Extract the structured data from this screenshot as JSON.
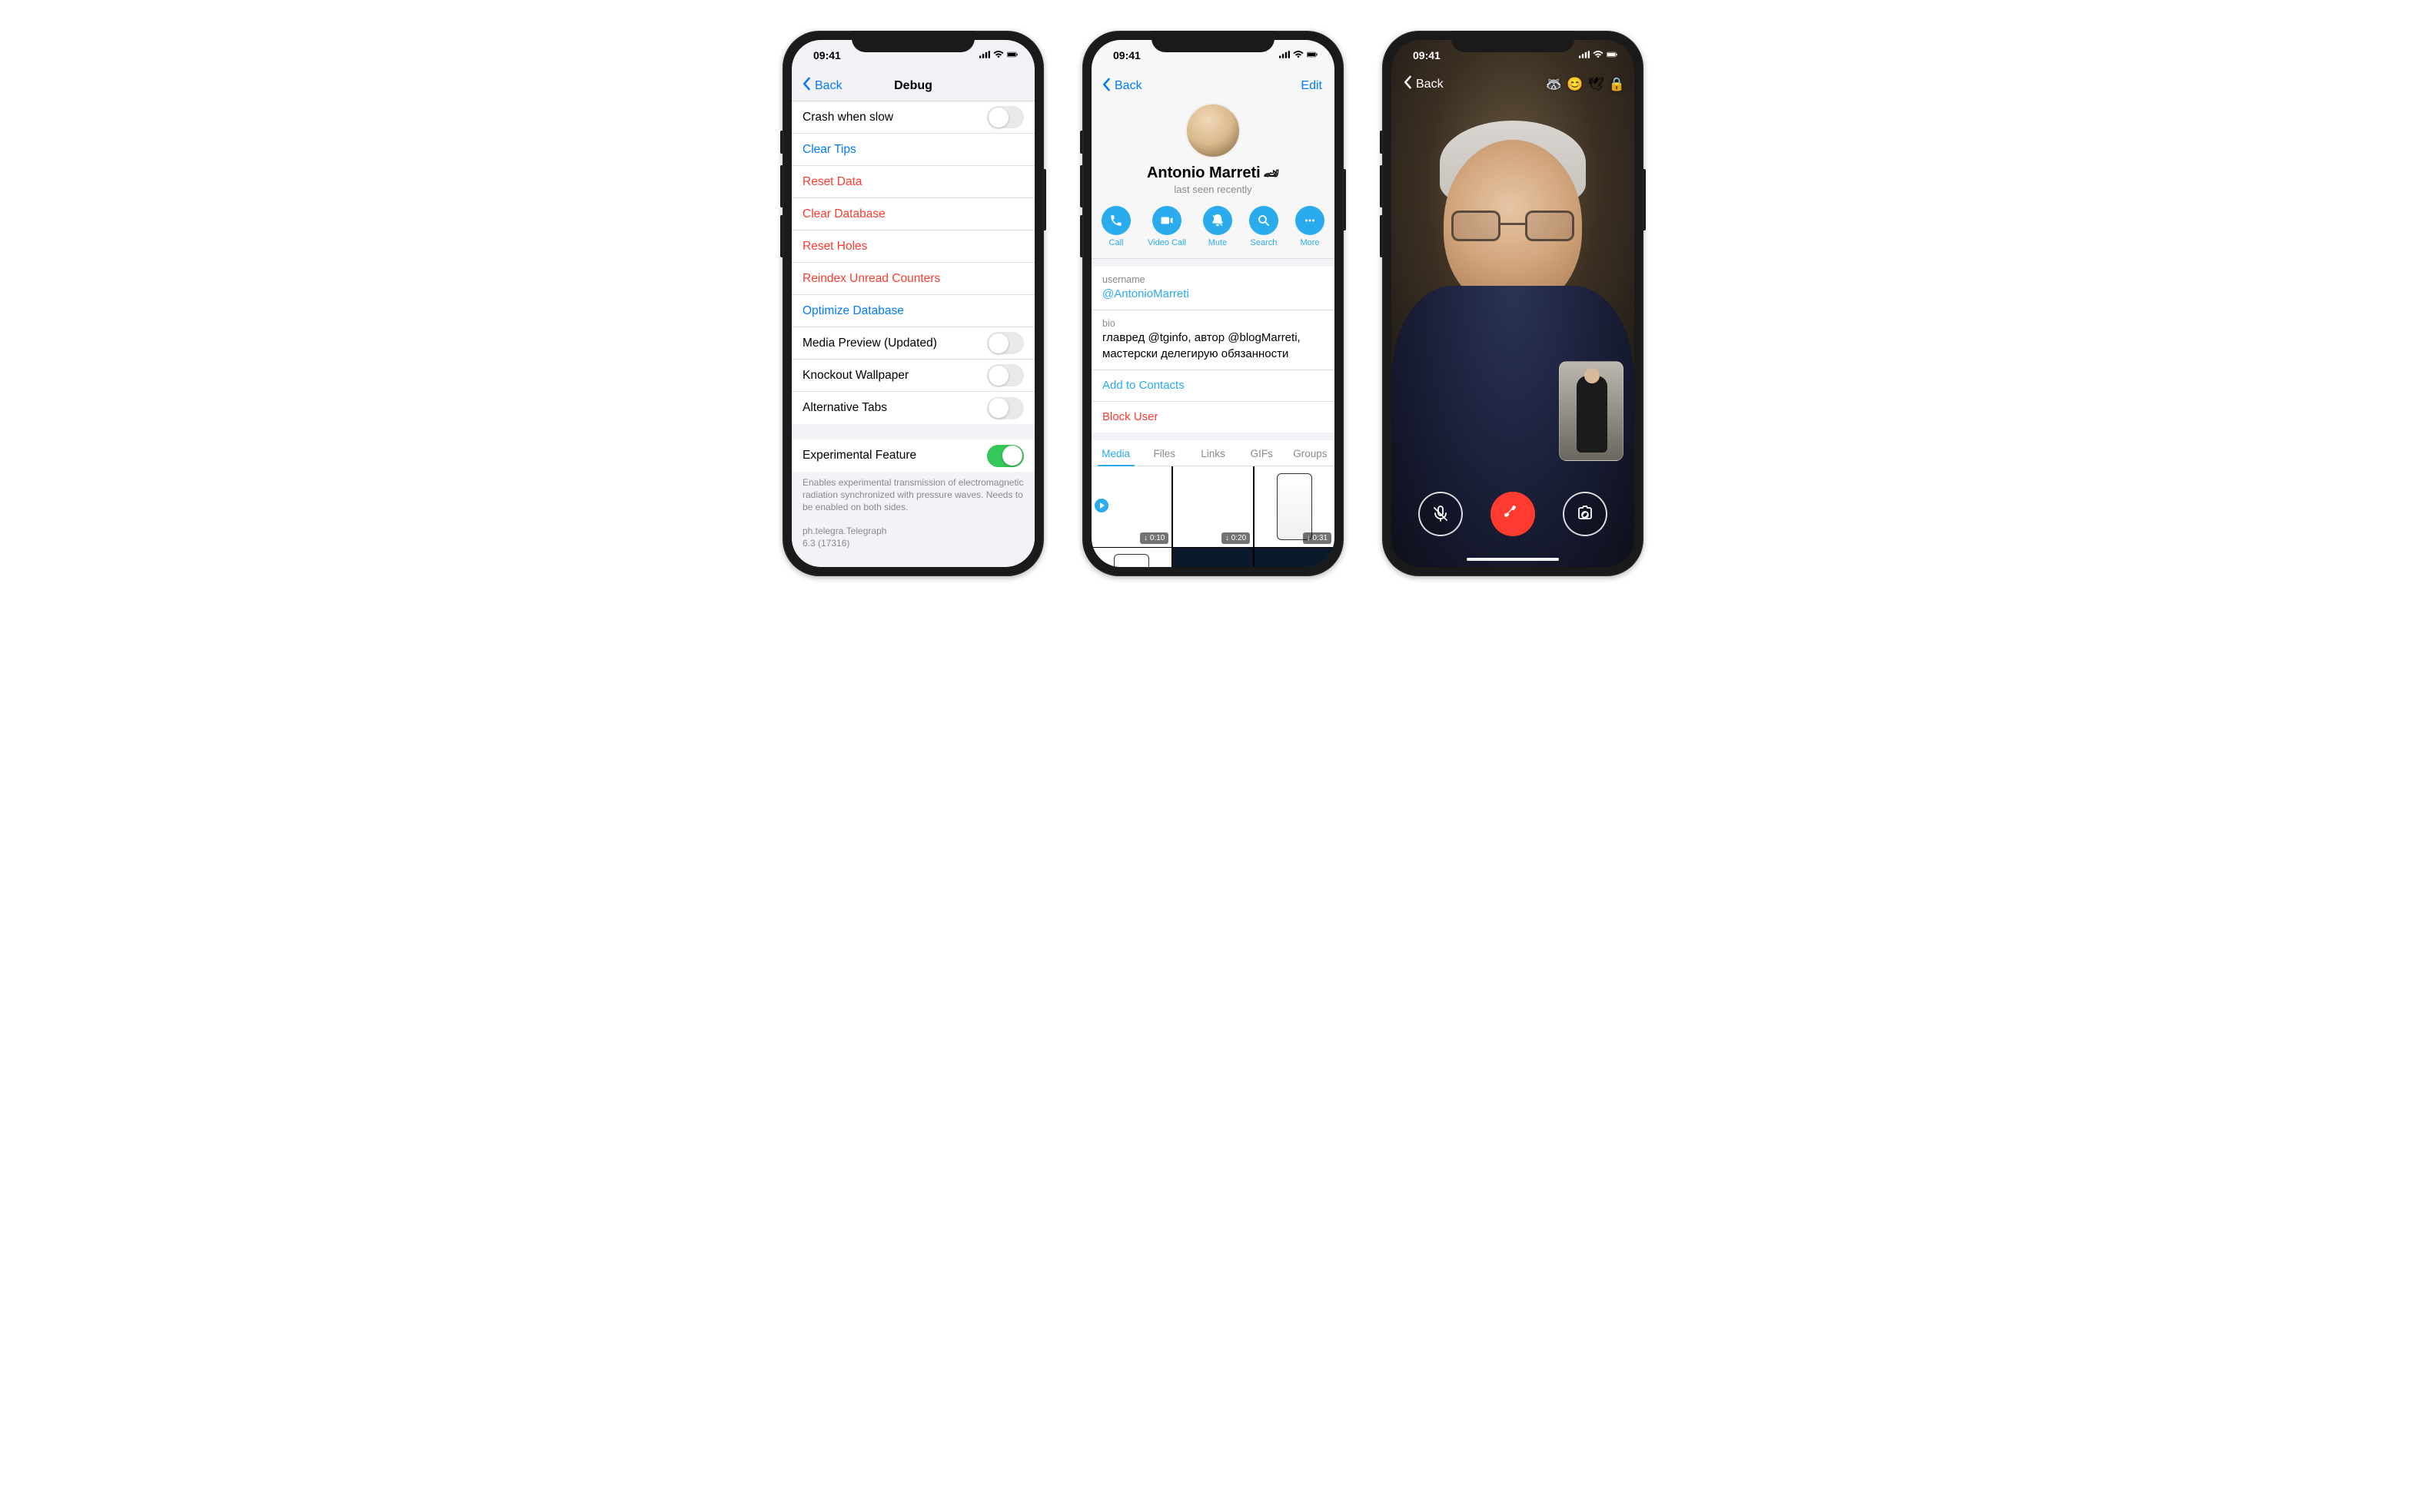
{
  "status": {
    "time": "09:41"
  },
  "p1": {
    "back": "Back",
    "title": "Debug",
    "rows": {
      "crash_slow": "Crash when slow",
      "clear_tips": "Clear Tips",
      "reset_data": "Reset Data",
      "clear_db": "Clear Database",
      "reset_holes": "Reset Holes",
      "reindex": "Reindex Unread Counters",
      "optimize_db": "Optimize Database",
      "media_preview": "Media Preview (Updated)",
      "knockout": "Knockout Wallpaper",
      "alt_tabs": "Alternative Tabs",
      "experimental": "Experimental Feature"
    },
    "footer1": "Enables experimental transmission of electromagnetic radiation synchronized with pressure waves. Needs to be enabled on both sides.",
    "footer2a": "ph.telegra.Telegraph",
    "footer2b": "6.3 (17316)"
  },
  "p2": {
    "back": "Back",
    "edit": "Edit",
    "name": "Antonio Marreti",
    "name_emoji": "🏎",
    "status": "last seen recently",
    "actions": {
      "call": "Call",
      "video": "Video Call",
      "mute": "Mute",
      "search": "Search",
      "more": "More"
    },
    "username_label": "username",
    "username": "@AntonioMarreti",
    "bio_label": "bio",
    "bio": "главред @tginfo, автор @blogMarreti, мастерски делегирую обязанности",
    "add_contacts": "Add to Contacts",
    "block": "Block User",
    "tabs": {
      "media": "Media",
      "files": "Files",
      "links": "Links",
      "gifs": "GIFs",
      "groups": "Groups"
    },
    "badges": {
      "b1": "↓ 0:10",
      "b2": "↓ 0:20",
      "b3": "↓ 0:31"
    }
  },
  "p3": {
    "back": "Back",
    "top_emojis": [
      "🦝",
      "😊",
      "🕊",
      "🔒"
    ]
  }
}
